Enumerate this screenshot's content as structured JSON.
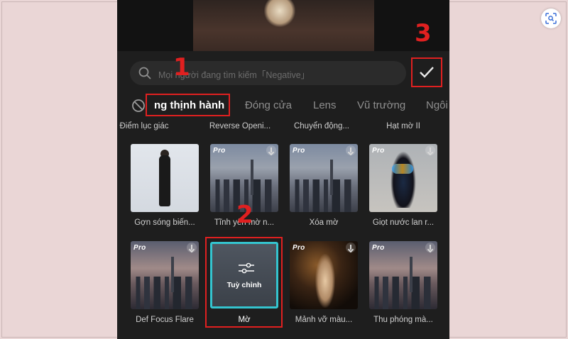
{
  "search": {
    "placeholder": "Mọi người đang tìm kiếm「Negative」"
  },
  "tabs": [
    "ng thịnh hành",
    "Đóng cửa",
    "Lens",
    "Vũ trường",
    "Ngôi"
  ],
  "top_labels": [
    "Điểm lục giác",
    "Reverse Openi...",
    "Chuyển động...",
    "Hạt mờ II"
  ],
  "row1": [
    {
      "label": "Gợn sóng biến...",
      "pro": false
    },
    {
      "label": "Tĩnh yên mờ n...",
      "pro": true
    },
    {
      "label": "Xóa mờ",
      "pro": true
    },
    {
      "label": "Giọt nước lan r...",
      "pro": true
    }
  ],
  "row2": [
    {
      "label": "Def Focus Flare",
      "pro": true
    },
    {
      "label": "Mờ",
      "pro": false,
      "overlay": "Tuỳ chỉnh"
    },
    {
      "label": "Mảnh vỡ màu...",
      "pro": true
    },
    {
      "label": "Thu phóng mà...",
      "pro": true
    }
  ],
  "badge_text": "Pro",
  "annotations": [
    "1",
    "2",
    "3"
  ],
  "colors": {
    "highlight_red": "#e02020",
    "selected_cyan": "#34c4cf",
    "page_bg": "#ead6d6"
  }
}
